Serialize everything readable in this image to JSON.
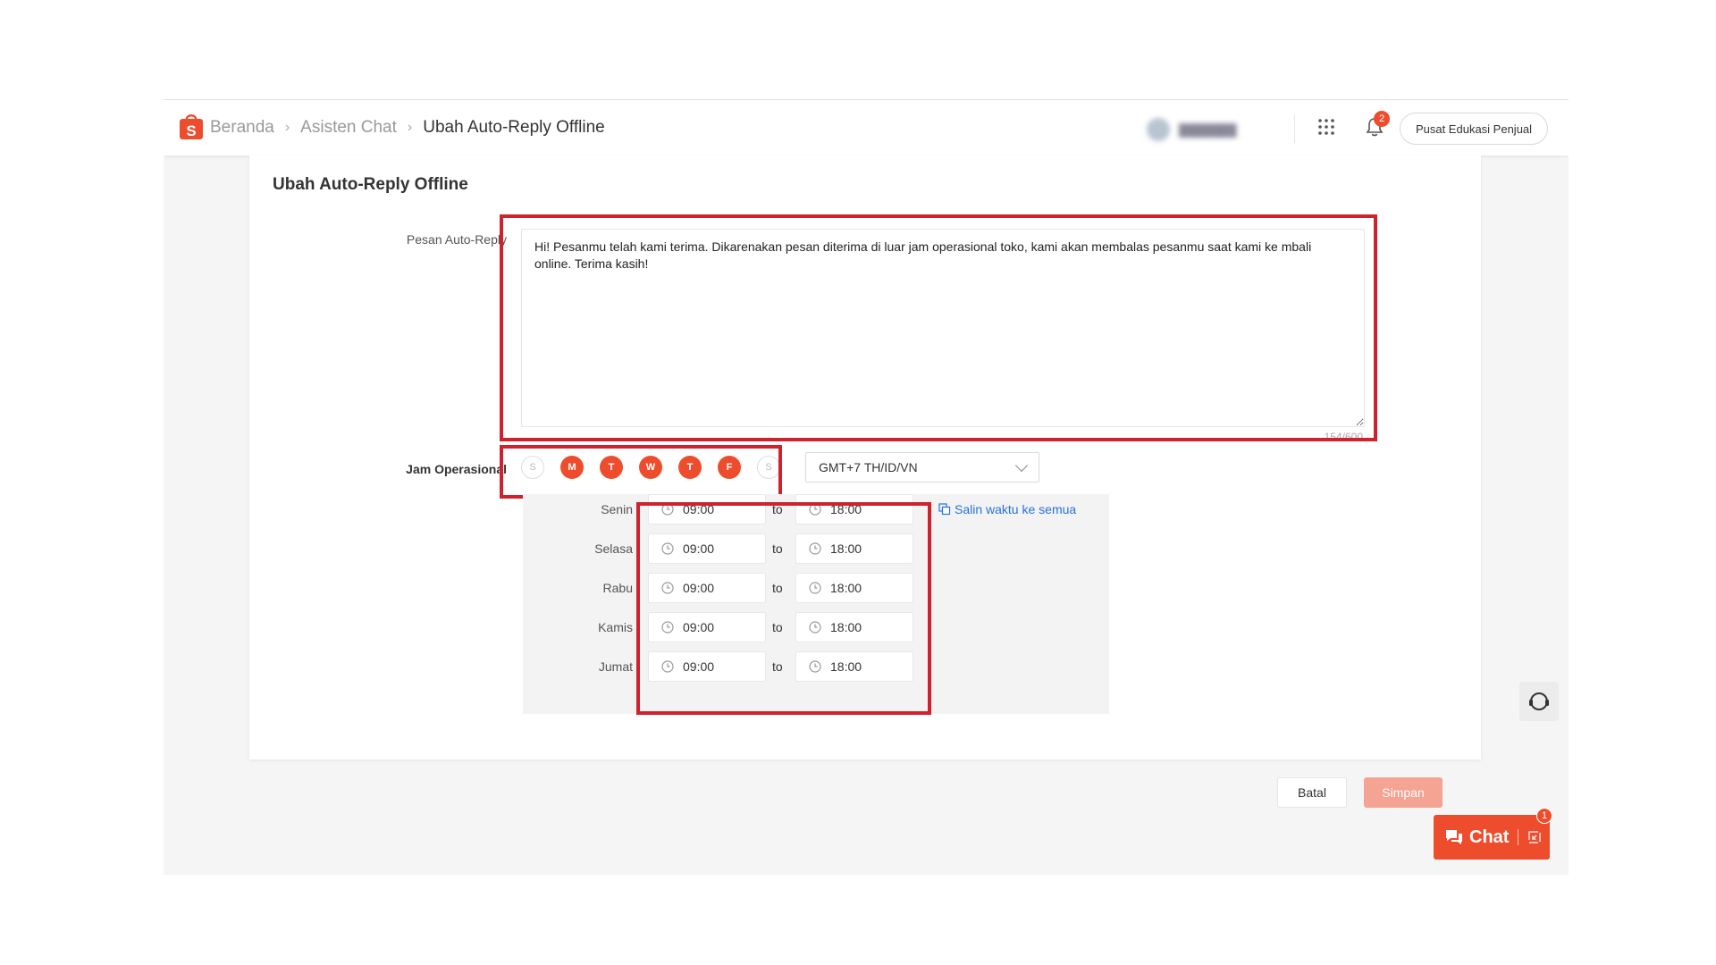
{
  "breadcrumb": [
    "Beranda",
    "Asisten Chat",
    "Ubah Auto-Reply Offline"
  ],
  "header": {
    "notification_count": "2",
    "edu_button": "Pusat Edukasi Penjual"
  },
  "form": {
    "title": "Ubah Auto-Reply Offline",
    "message_label": "Pesan Auto-Reply",
    "message_value": "Hi! Pesanmu telah kami terima. Dikarenakan pesan diterima di luar jam operasional toko, kami akan membalas pesanmu saat kami ke mbali online. Terima kasih!",
    "char_counter": "154/600",
    "hours_label": "Jam Operasional",
    "days": [
      {
        "letter": "S",
        "active": false
      },
      {
        "letter": "M",
        "active": true
      },
      {
        "letter": "T",
        "active": true
      },
      {
        "letter": "W",
        "active": true
      },
      {
        "letter": "T",
        "active": true
      },
      {
        "letter": "F",
        "active": true
      },
      {
        "letter": "S",
        "active": false
      }
    ],
    "timezone": "GMT+7 TH/ID/VN",
    "to_label": "to",
    "copy_link": "Salin waktu ke semua",
    "schedule": [
      {
        "day": "Senin",
        "start": "09:00",
        "end": "18:00"
      },
      {
        "day": "Selasa",
        "start": "09:00",
        "end": "18:00"
      },
      {
        "day": "Rabu",
        "start": "09:00",
        "end": "18:00"
      },
      {
        "day": "Kamis",
        "start": "09:00",
        "end": "18:00"
      },
      {
        "day": "Jumat",
        "start": "09:00",
        "end": "18:00"
      }
    ]
  },
  "actions": {
    "cancel": "Batal",
    "save": "Simpan"
  },
  "chat_widget": {
    "label": "Chat",
    "badge": "1"
  },
  "colors": {
    "brand": "#ee4d2d",
    "highlight": "#d0222c",
    "link": "#2673dd"
  }
}
